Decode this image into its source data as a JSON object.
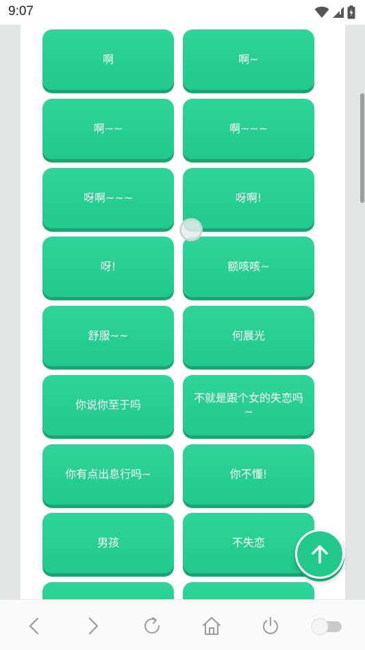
{
  "status": {
    "time": "9:07"
  },
  "colors": {
    "button": "#22c98c",
    "button_shadow": "#17a673",
    "page_bg": "#e2e7e4"
  },
  "buttons": [
    {
      "label": "啊"
    },
    {
      "label": "啊~"
    },
    {
      "label": "啊~~"
    },
    {
      "label": "啊~~~"
    },
    {
      "label": "呀啊~~~"
    },
    {
      "label": "呀啊!"
    },
    {
      "label": "呀!"
    },
    {
      "label": "额咳咳~"
    },
    {
      "label": "舒服~~"
    },
    {
      "label": "何晨光"
    },
    {
      "label": "你说你至于吗"
    },
    {
      "label": "不就是跟个女的失恋吗~"
    },
    {
      "label": "你有点出息行吗~"
    },
    {
      "label": "你不懂!"
    },
    {
      "label": "男孩"
    },
    {
      "label": "不失恋"
    },
    {
      "label": ""
    },
    {
      "label": ""
    }
  ],
  "icons": {
    "fab": "arrow-up-icon",
    "nav": [
      "back-icon",
      "forward-icon",
      "refresh-icon",
      "home-icon",
      "power-icon",
      "toggle-switch"
    ]
  }
}
